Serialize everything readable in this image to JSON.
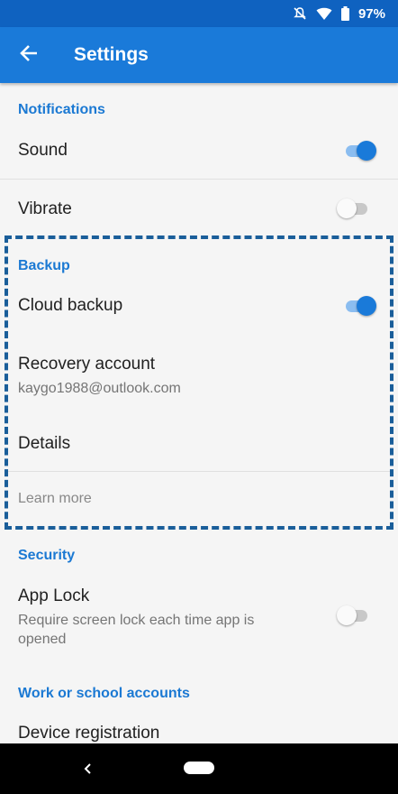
{
  "status_bar": {
    "battery_text": "97%",
    "icons": [
      "bell-off-icon",
      "wifi-icon",
      "battery-icon"
    ]
  },
  "app_bar": {
    "title": "Settings",
    "back_icon": "arrow-left-icon"
  },
  "sections": {
    "notifications": {
      "header": "Notifications",
      "sound": {
        "label": "Sound",
        "enabled": true
      },
      "vibrate": {
        "label": "Vibrate",
        "enabled": false
      }
    },
    "backup": {
      "header": "Backup",
      "cloud_backup": {
        "label": "Cloud backup",
        "enabled": true
      },
      "recovery_account": {
        "label": "Recovery account",
        "value": "kaygo1988@outlook.com"
      },
      "details": {
        "label": "Details"
      },
      "learn_more": "Learn more"
    },
    "security": {
      "header": "Security",
      "app_lock": {
        "label": "App Lock",
        "description": "Require screen lock each time app is opened",
        "enabled": false
      }
    },
    "work_accounts": {
      "header": "Work or school accounts",
      "device_registration": {
        "label": "Device registration"
      }
    }
  },
  "colors": {
    "status_bar": "#0f62c0",
    "app_bar": "#1a7ad9",
    "accent": "#1b79d3",
    "highlight_border": "#1a5e9a"
  }
}
